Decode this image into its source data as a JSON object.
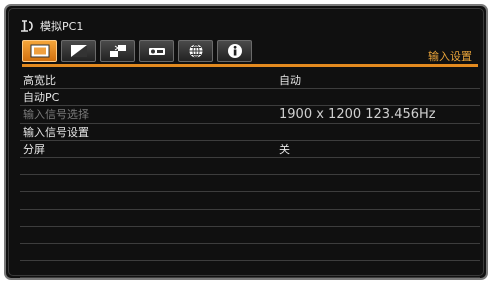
{
  "header": {
    "source_name": "模拟PC1",
    "section": "输入设置"
  },
  "tabs": [
    {
      "name": "tab-image",
      "icon": "picture-icon",
      "active": true
    },
    {
      "name": "tab-adjust",
      "icon": "contrast-icon",
      "active": false
    },
    {
      "name": "tab-install",
      "icon": "install-icon",
      "active": false
    },
    {
      "name": "tab-system",
      "icon": "projector-icon",
      "active": false
    },
    {
      "name": "tab-network",
      "icon": "globe-icon",
      "active": false
    },
    {
      "name": "tab-info",
      "icon": "info-icon",
      "active": false
    }
  ],
  "rows": [
    {
      "label": "高宽比",
      "value": "自动"
    },
    {
      "label": "自动PC",
      "value": ""
    },
    {
      "label": "输入信号选择",
      "value": "1900 x 1200 123.456Hz",
      "disabled": true
    },
    {
      "label": "输入信号设置",
      "value": ""
    },
    {
      "label": "分屏",
      "value": "关"
    },
    {
      "label": "",
      "value": ""
    },
    {
      "label": "",
      "value": ""
    },
    {
      "label": "",
      "value": ""
    },
    {
      "label": "",
      "value": ""
    },
    {
      "label": "",
      "value": ""
    },
    {
      "label": "",
      "value": ""
    },
    {
      "label": "",
      "value": ""
    }
  ],
  "colors": {
    "accent": "#e38a1f",
    "section_text": "#e8a33a",
    "background": "#101010"
  }
}
